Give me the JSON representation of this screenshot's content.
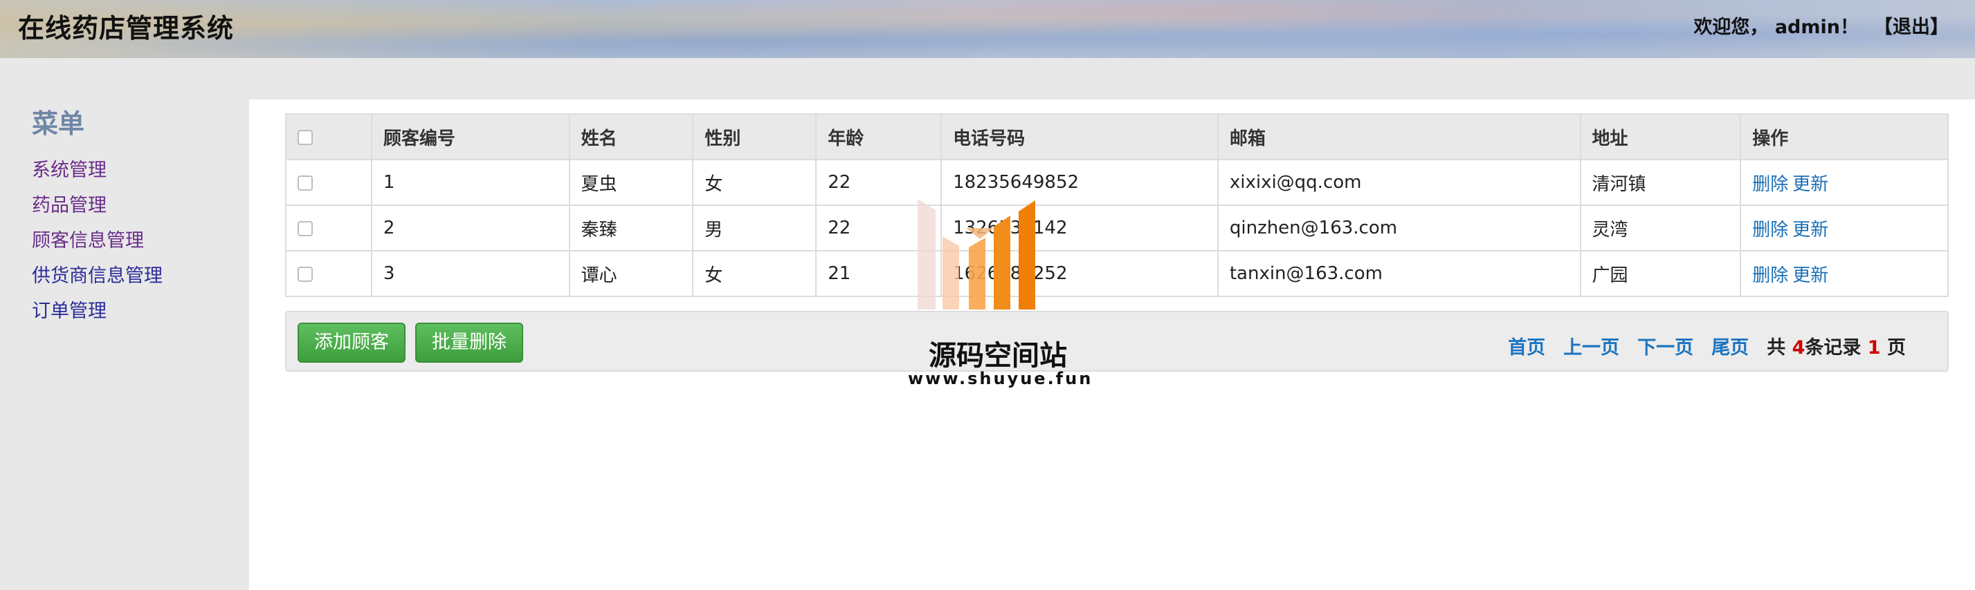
{
  "header": {
    "app_title": "在线药店管理系统",
    "welcome": "欢迎您， admin！",
    "logout": "【退出】"
  },
  "sidebar": {
    "title": "菜单",
    "items": [
      {
        "label": "系统管理"
      },
      {
        "label": "药品管理"
      },
      {
        "label": "顾客信息管理"
      },
      {
        "label": "供货商信息管理"
      },
      {
        "label": "订单管理"
      }
    ]
  },
  "table": {
    "columns": [
      "顾客编号",
      "姓名",
      "性别",
      "年龄",
      "电话号码",
      "邮箱",
      "地址",
      "操作"
    ],
    "rows": [
      {
        "id": "1",
        "name": "夏虫",
        "gender": "女",
        "age": "22",
        "phone": "18235649852",
        "email": "xixixi@qq.com",
        "address": "清河镇"
      },
      {
        "id": "2",
        "name": "秦臻",
        "gender": "男",
        "age": "22",
        "phone": "1326532142",
        "email": "qinzhen@163.com",
        "address": "灵湾"
      },
      {
        "id": "3",
        "name": "谭心",
        "gender": "女",
        "age": "21",
        "phone": "1626586252",
        "email": "tanxin@163.com",
        "address": "广园"
      }
    ],
    "actions": {
      "delete": "删除",
      "update": "更新"
    }
  },
  "footer": {
    "add_button": "添加顾客",
    "batch_delete_button": "批量删除",
    "pager": {
      "first": "首页",
      "prev": "上一页",
      "next": "下一页",
      "last": "尾页",
      "total_prefix": "共",
      "total_records": "4",
      "records_suffix": "条记录",
      "total_pages": "1",
      "pages_suffix": "页"
    }
  },
  "watermark": {
    "title": "源码空间站",
    "url": "www.shuyue.fun"
  },
  "colors": {
    "link": "#1b74c0",
    "button_green": "#4cae4c",
    "count_red": "#d00000",
    "menu_title": "#6f86a6"
  }
}
